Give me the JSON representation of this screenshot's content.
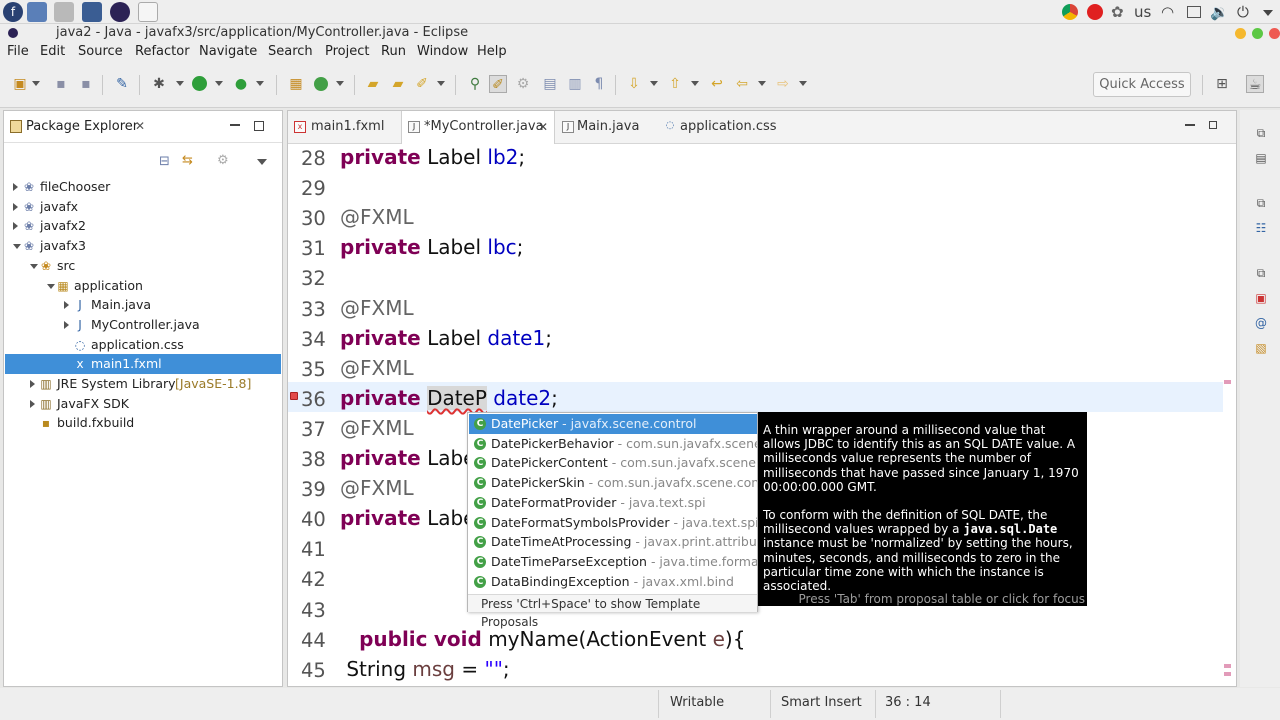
{
  "window": {
    "title": "java2 - Java - javafx3/src/application/MyController.java - Eclipse",
    "tray": {
      "keyboard_layout": "us"
    }
  },
  "menu": [
    "File",
    "Edit",
    "Source",
    "Refactor",
    "Navigate",
    "Search",
    "Project",
    "Run",
    "Window",
    "Help"
  ],
  "toolbar": {
    "quick_access": "Quick Access"
  },
  "package_explorer": {
    "title": "Package Explorer",
    "tree": [
      {
        "label": "fileChooser",
        "depth": 0,
        "toggle": "closed",
        "icon": "project-icon"
      },
      {
        "label": "javafx",
        "depth": 0,
        "toggle": "closed",
        "icon": "project-icon"
      },
      {
        "label": "javafx2",
        "depth": 0,
        "toggle": "closed",
        "icon": "project-icon"
      },
      {
        "label": "javafx3",
        "depth": 0,
        "toggle": "open",
        "icon": "project-icon"
      },
      {
        "label": "src",
        "depth": 1,
        "toggle": "open",
        "icon": "source-folder-icon"
      },
      {
        "label": "application",
        "depth": 2,
        "toggle": "open",
        "icon": "package-icon"
      },
      {
        "label": "Main.java",
        "depth": 3,
        "toggle": "closed",
        "icon": "java-file-icon"
      },
      {
        "label": "MyController.java",
        "depth": 3,
        "toggle": "closed",
        "icon": "java-file-icon"
      },
      {
        "label": "application.css",
        "depth": 3,
        "toggle": "none",
        "icon": "css-file-icon"
      },
      {
        "label": "main1.fxml",
        "depth": 3,
        "toggle": "none",
        "icon": "fxml-file-icon",
        "selected": true
      },
      {
        "label": "JRE System Library",
        "decoration": "[JavaSE-1.8]",
        "depth": 1,
        "toggle": "closed",
        "icon": "library-icon"
      },
      {
        "label": "JavaFX SDK",
        "depth": 1,
        "toggle": "closed",
        "icon": "library-icon"
      },
      {
        "label": "build.fxbuild",
        "depth": 1,
        "toggle": "none",
        "icon": "build-file-icon"
      }
    ]
  },
  "editor": {
    "tabs": [
      {
        "label": "main1.fxml",
        "active": false
      },
      {
        "label": "*MyController.java",
        "active": true
      },
      {
        "label": "Main.java",
        "active": false
      },
      {
        "label": "application.css",
        "active": false
      }
    ],
    "lines": [
      {
        "n": "28",
        "tokens": [
          [
            "kw",
            "private"
          ],
          [
            "sp",
            " "
          ],
          [
            "ty",
            "Label"
          ],
          [
            "sp",
            " "
          ],
          [
            "fld",
            "lb2"
          ],
          [
            "ty",
            ";"
          ]
        ]
      },
      {
        "n": "29",
        "tokens": []
      },
      {
        "n": "30",
        "tokens": [
          [
            "ann",
            "@FXML"
          ]
        ]
      },
      {
        "n": "31",
        "tokens": [
          [
            "kw",
            "private"
          ],
          [
            "sp",
            " "
          ],
          [
            "ty",
            "Label"
          ],
          [
            "sp",
            " "
          ],
          [
            "fld",
            "lbc"
          ],
          [
            "ty",
            ";"
          ]
        ]
      },
      {
        "n": "32",
        "tokens": []
      },
      {
        "n": "33",
        "tokens": [
          [
            "ann",
            "@FXML"
          ]
        ]
      },
      {
        "n": "34",
        "tokens": [
          [
            "kw",
            "private"
          ],
          [
            "sp",
            " "
          ],
          [
            "ty",
            "Label"
          ],
          [
            "sp",
            " "
          ],
          [
            "fld",
            "date1"
          ],
          [
            "ty",
            ";"
          ]
        ]
      },
      {
        "n": "35",
        "tokens": [
          [
            "ann",
            "@FXML"
          ]
        ]
      },
      {
        "n": "36",
        "tokens": [
          [
            "kw",
            "private"
          ],
          [
            "sp",
            " "
          ],
          [
            "ty",
            "DateP"
          ],
          [
            "sp",
            " "
          ],
          [
            "fld",
            "date2"
          ],
          [
            "ty",
            ";"
          ]
        ]
      },
      {
        "n": "37",
        "tokens": [
          [
            "ann",
            "@FXML"
          ]
        ]
      },
      {
        "n": "38",
        "tokens": [
          [
            "kw",
            "private"
          ],
          [
            "sp",
            " "
          ],
          [
            "ty",
            "Labe"
          ]
        ]
      },
      {
        "n": "39",
        "tokens": [
          [
            "ann",
            "@FXML"
          ]
        ]
      },
      {
        "n": "40",
        "tokens": [
          [
            "kw",
            "private"
          ],
          [
            "sp",
            " "
          ],
          [
            "ty",
            "Labe"
          ]
        ]
      },
      {
        "n": "41",
        "tokens": []
      },
      {
        "n": "42",
        "tokens": []
      },
      {
        "n": "43",
        "tokens": []
      },
      {
        "n": "44",
        "tokens": [
          [
            "sp",
            "   "
          ],
          [
            "kw",
            "public"
          ],
          [
            "sp",
            " "
          ],
          [
            "kw",
            "void"
          ],
          [
            "sp",
            " "
          ],
          [
            "ty",
            "myName(ActionEvent "
          ],
          [
            "par",
            "e"
          ],
          [
            "ty",
            "){"
          ]
        ]
      },
      {
        "n": "45",
        "tokens": [
          [
            "sp",
            " "
          ],
          [
            "ty",
            "String "
          ],
          [
            "par",
            "msg"
          ],
          [
            "ty",
            " = "
          ],
          [
            "str",
            "\"\""
          ],
          [
            "ty",
            ";"
          ]
        ]
      }
    ]
  },
  "content_assist": {
    "proposals": [
      {
        "name": "DatePicker",
        "pkg": " - javafx.scene.control",
        "selected": true
      },
      {
        "name": "DatePickerBehavior",
        "pkg": " - com.sun.javafx.scene.co"
      },
      {
        "name": "DatePickerContent",
        "pkg": " - com.sun.javafx.scene.co"
      },
      {
        "name": "DatePickerSkin",
        "pkg": " - com.sun.javafx.scene.control"
      },
      {
        "name": "DateFormatProvider",
        "pkg": " - java.text.spi"
      },
      {
        "name": "DateFormatSymbolsProvider",
        "pkg": " - java.text.spi"
      },
      {
        "name": "DateTimeAtProcessing",
        "pkg": " - javax.print.attribute"
      },
      {
        "name": "DateTimeParseException",
        "pkg": " - java.time.format"
      },
      {
        "name": "DataBindingException",
        "pkg": " - javax.xml.bind"
      }
    ],
    "footer": "Press 'Ctrl+Space' to show Template Proposals"
  },
  "javadoc": {
    "para1": "A thin wrapper around a millisecond value that allows JDBC to identify this as an SQL DATE value. A milliseconds value represents the number of milliseconds that have passed since January 1, 1970 00:00:00.000 GMT.",
    "para2_a": "To conform with the definition of SQL DATE, the millisecond values wrapped by a ",
    "para2_code": "java.sql.Date",
    "para2_b": " instance must be 'normalized' by setting the hours, minutes, seconds, and milliseconds to zero in the particular time zone with which the instance is associated.",
    "footer": "Press 'Tab' from proposal table or click for focus"
  },
  "status": {
    "mode": "Writable",
    "insert": "Smart Insert",
    "position": "36 : 14"
  },
  "colors": {
    "keyword": "#7f0055",
    "field": "#0000c0",
    "annotation": "#646464",
    "selection": "#3f8fd8"
  }
}
